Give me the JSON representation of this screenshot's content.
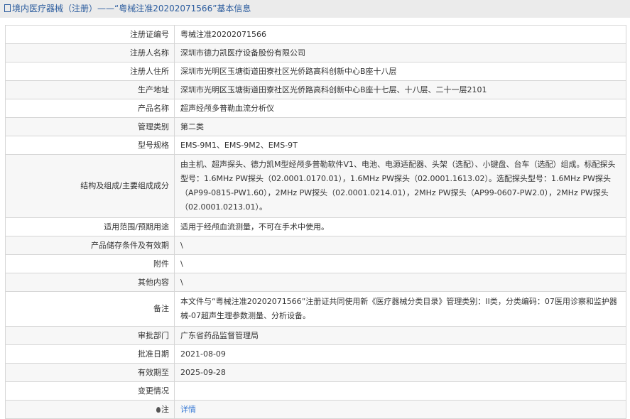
{
  "header": {
    "title": "境内医疗器械（注册）——“粤械注准20202071566”基本信息"
  },
  "rows": [
    {
      "label": "注册证编号",
      "value": "粤械注准20202071566"
    },
    {
      "label": "注册人名称",
      "value": "深圳市德力凯医疗设备股份有限公司"
    },
    {
      "label": "注册人住所",
      "value": "深圳市光明区玉塘街道田寮社区光侨路高科创新中心B座十八层"
    },
    {
      "label": "生产地址",
      "value": "深圳市光明区玉塘街道田寮社区光侨路高科创新中心B座十七层、十八层、二十一层2101"
    },
    {
      "label": "产品名称",
      "value": "超声经颅多普勒血流分析仪"
    },
    {
      "label": "管理类别",
      "value": "第二类"
    },
    {
      "label": "型号规格",
      "value": "EMS-9M1、EMS-9M2、EMS-9T"
    },
    {
      "label": "结构及组成/主要组成成分",
      "value": "由主机、超声探头、德力凯M型经颅多普勒软件V1、电池、电源适配器、头架（选配）、小键盘、台车（选配）组成。标配探头型号：1.6MHz PW探头（02.0001.0170.01），1.6MHz PW探头（02.0001.1613.02）。选配探头型号：1.6MHz PW探头（AP99-0815-PW1.60），2MHz PW探头（02.0001.0214.01），2MHz PW探头（AP99-0607-PW2.0），2MHz PW探头（02.0001.0213.01）。"
    },
    {
      "label": "适用范围/预期用途",
      "value": "适用于经颅血流测量，不可在手术中使用。"
    },
    {
      "label": "产品储存条件及有效期",
      "value": "\\"
    },
    {
      "label": "附件",
      "value": "\\"
    },
    {
      "label": "其他内容",
      "value": "\\"
    },
    {
      "label": "备注",
      "value": "本文件与“粤械注准20202071566”注册证共同使用新《医疗器械分类目录》管理类别：II类，分类编码：07医用诊察和监护器械-07超声生理参数测量、分析设备。"
    },
    {
      "label": "审批部门",
      "value": "广东省药品监督管理局"
    },
    {
      "label": "批准日期",
      "value": "2021-08-09"
    },
    {
      "label": "有效期至",
      "value": "2025-09-28"
    },
    {
      "label": "变更情况",
      "value": ""
    }
  ],
  "note": {
    "label": "注",
    "link": "详情"
  }
}
